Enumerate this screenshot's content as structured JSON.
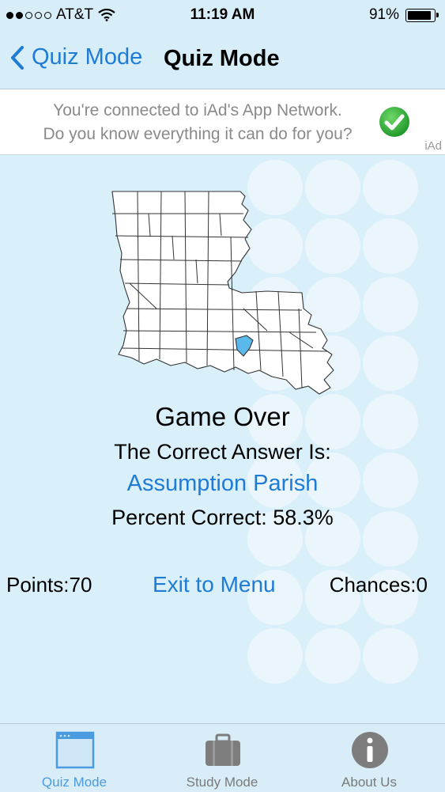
{
  "status_bar": {
    "carrier": "AT&T",
    "time": "11:19 AM",
    "battery": "91%",
    "battery_level": 0.91,
    "signal_bars": 2
  },
  "nav": {
    "back_label": "Quiz Mode",
    "title": "Quiz Mode"
  },
  "ad": {
    "line1": "You're connected to iAd's App Network.",
    "line2": "Do you know everything it can do for you?",
    "brand": "iAd"
  },
  "result": {
    "heading": "Game Over",
    "answer_label": "The Correct Answer Is:",
    "answer": "Assumption Parish",
    "percent": "Percent Correct: 58.3%"
  },
  "footer": {
    "points": "Points:70",
    "exit_label": "Exit to Menu",
    "chances": "Chances:0"
  },
  "tabs": [
    {
      "label": "Quiz Mode",
      "icon": "window-icon",
      "active": true
    },
    {
      "label": "Study Mode",
      "icon": "briefcase-icon",
      "active": false
    },
    {
      "label": "About Us",
      "icon": "info-icon",
      "active": false
    }
  ],
  "colors": {
    "accent": "#1e7cd6",
    "highlight_parish": "#5bb8ea",
    "background": "#d9eff9"
  }
}
